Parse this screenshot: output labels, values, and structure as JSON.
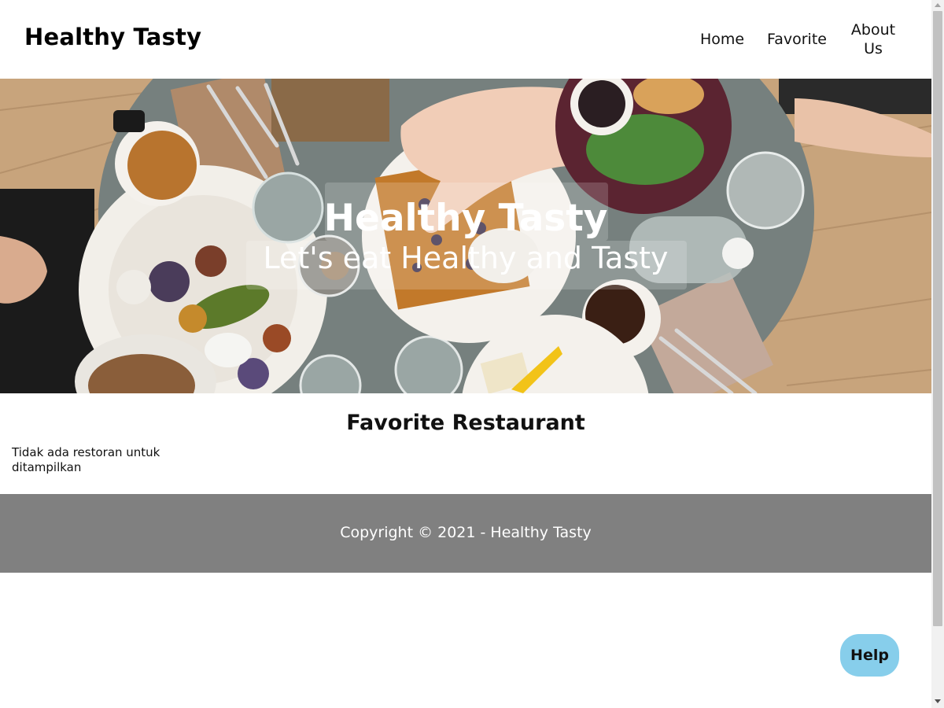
{
  "header": {
    "brand": "Healthy Tasty",
    "nav": {
      "home": "Home",
      "favorite": "Favorite",
      "about_line1": "About",
      "about_line2": "Us"
    }
  },
  "hero": {
    "title": "Healthy Tasty",
    "tagline": "Let's eat Healthy and Tasty",
    "image_icon": "food-table-photo"
  },
  "main": {
    "section_title": "Favorite Restaurant",
    "empty_message": "Tidak ada restoran untuk ditampilkan"
  },
  "footer": {
    "copyright": "Copyright © 2021 - Healthy Tasty"
  },
  "help": {
    "label": "Help"
  },
  "colors": {
    "footer_bg": "#808080",
    "help_bg": "#87ceeb",
    "table_grey": "#6e7a78",
    "wood": "#c9a47a"
  }
}
